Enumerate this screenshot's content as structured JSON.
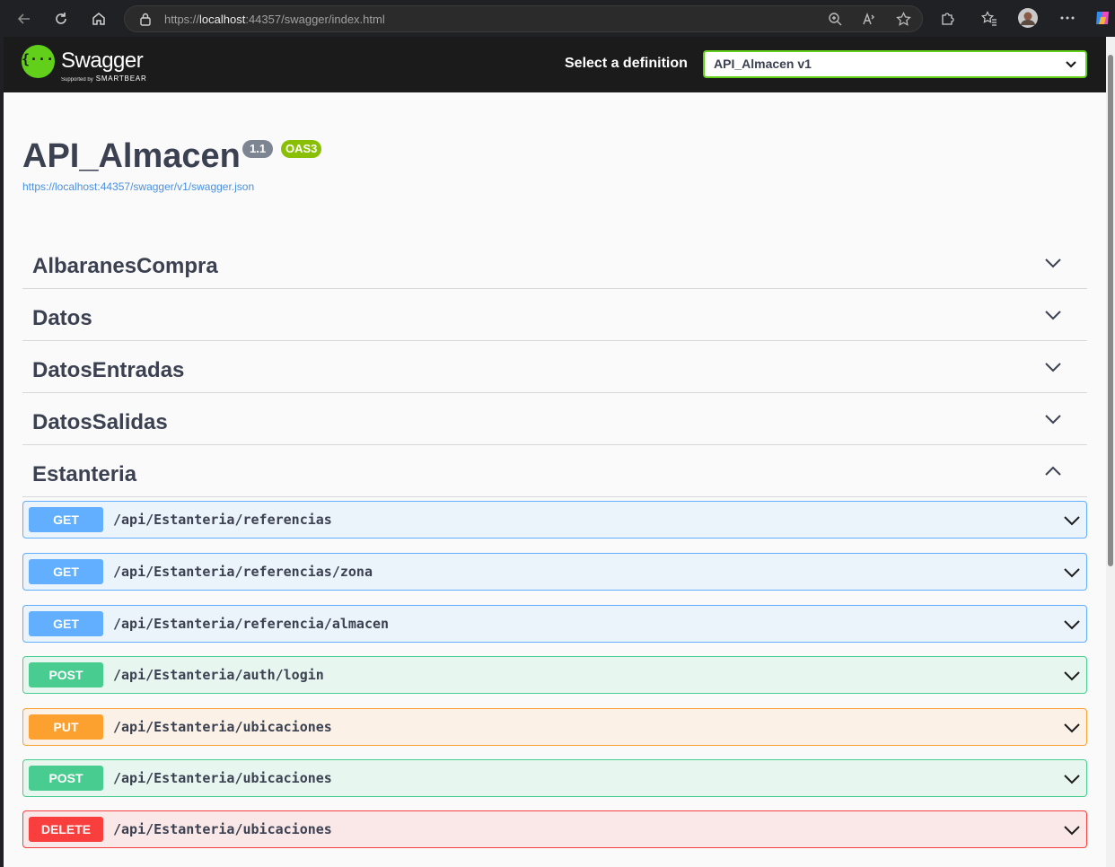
{
  "browser": {
    "url_prefix": "https://",
    "url_host": "localhost",
    "url_rest": ":44357/swagger/index.html"
  },
  "topbar": {
    "brand": "Swagger",
    "brand_supported": "Supported by",
    "brand_sub": "SMARTBEAR",
    "definition_label": "Select a definition",
    "definition_value": "API_Almacen v1"
  },
  "info": {
    "title": "API_Almacen",
    "version": "1.1",
    "oas": "OAS3",
    "spec_url": "https://localhost:44357/swagger/v1/swagger.json"
  },
  "tags": [
    {
      "name": "AlbaranesCompra",
      "expanded": false
    },
    {
      "name": "Datos",
      "expanded": false
    },
    {
      "name": "DatosEntradas",
      "expanded": false
    },
    {
      "name": "DatosSalidas",
      "expanded": false
    },
    {
      "name": "Estanteria",
      "expanded": true
    }
  ],
  "operations": [
    {
      "method": "GET",
      "path": "/api/Estanteria/referencias"
    },
    {
      "method": "GET",
      "path": "/api/Estanteria/referencias/zona"
    },
    {
      "method": "GET",
      "path": "/api/Estanteria/referencia/almacen"
    },
    {
      "method": "POST",
      "path": "/api/Estanteria/auth/login"
    },
    {
      "method": "PUT",
      "path": "/api/Estanteria/ubicaciones"
    },
    {
      "method": "POST",
      "path": "/api/Estanteria/ubicaciones"
    },
    {
      "method": "DELETE",
      "path": "/api/Estanteria/ubicaciones"
    }
  ],
  "colors": {
    "get": "#61affe",
    "post": "#49cc90",
    "put": "#fca130",
    "delete": "#f93e3e",
    "swagger_green": "#62d01a"
  }
}
